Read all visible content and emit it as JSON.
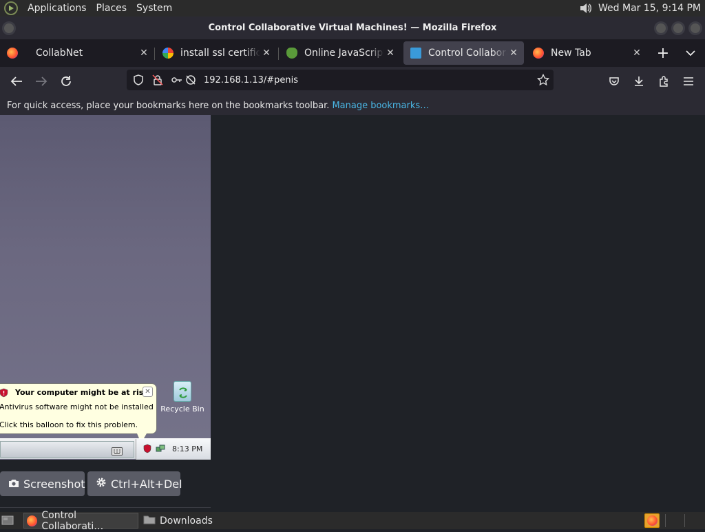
{
  "system_panel": {
    "menus": [
      "Applications",
      "Places",
      "System"
    ],
    "clock": "Wed Mar 15,  9:14 PM"
  },
  "window": {
    "title": "Control Collaborative Virtual Machines! — Mozilla Firefox"
  },
  "tabs": [
    {
      "label": "CollabNet",
      "icon": "firefox-icon",
      "active": false
    },
    {
      "label": "install ssl certificate",
      "icon": "google-icon",
      "active": false
    },
    {
      "label": "Online JavaScript be",
      "icon": "flower-icon",
      "active": false
    },
    {
      "label": "Control Collaborative",
      "icon": "monitor-icon",
      "active": true
    },
    {
      "label": "New Tab",
      "icon": "firefox-icon",
      "active": false
    }
  ],
  "navbar": {
    "url": "192.168.1.13/#penis"
  },
  "bookmarks_bar": {
    "message": "For quick access, place your bookmarks here on the bookmarks toolbar.",
    "link": "Manage bookmarks…"
  },
  "vm": {
    "balloon": {
      "title": "Your computer might be at risk",
      "line1": "Antivirus software might not be installed",
      "line2": "Click this balloon to fix this problem."
    },
    "recycle_bin_label": "Recycle Bin",
    "tray_time": "8:13 PM",
    "buttons": {
      "screenshot": "Screenshot",
      "ctrl_alt_del": "Ctrl+Alt+Del"
    }
  },
  "taskbar": {
    "items": [
      "Control Collaborati…",
      "Downloads"
    ]
  },
  "colors": {
    "accent_link": "#4ab7e6",
    "vm_background": "#6b6880",
    "balloon_bg": "#ffffe1"
  }
}
